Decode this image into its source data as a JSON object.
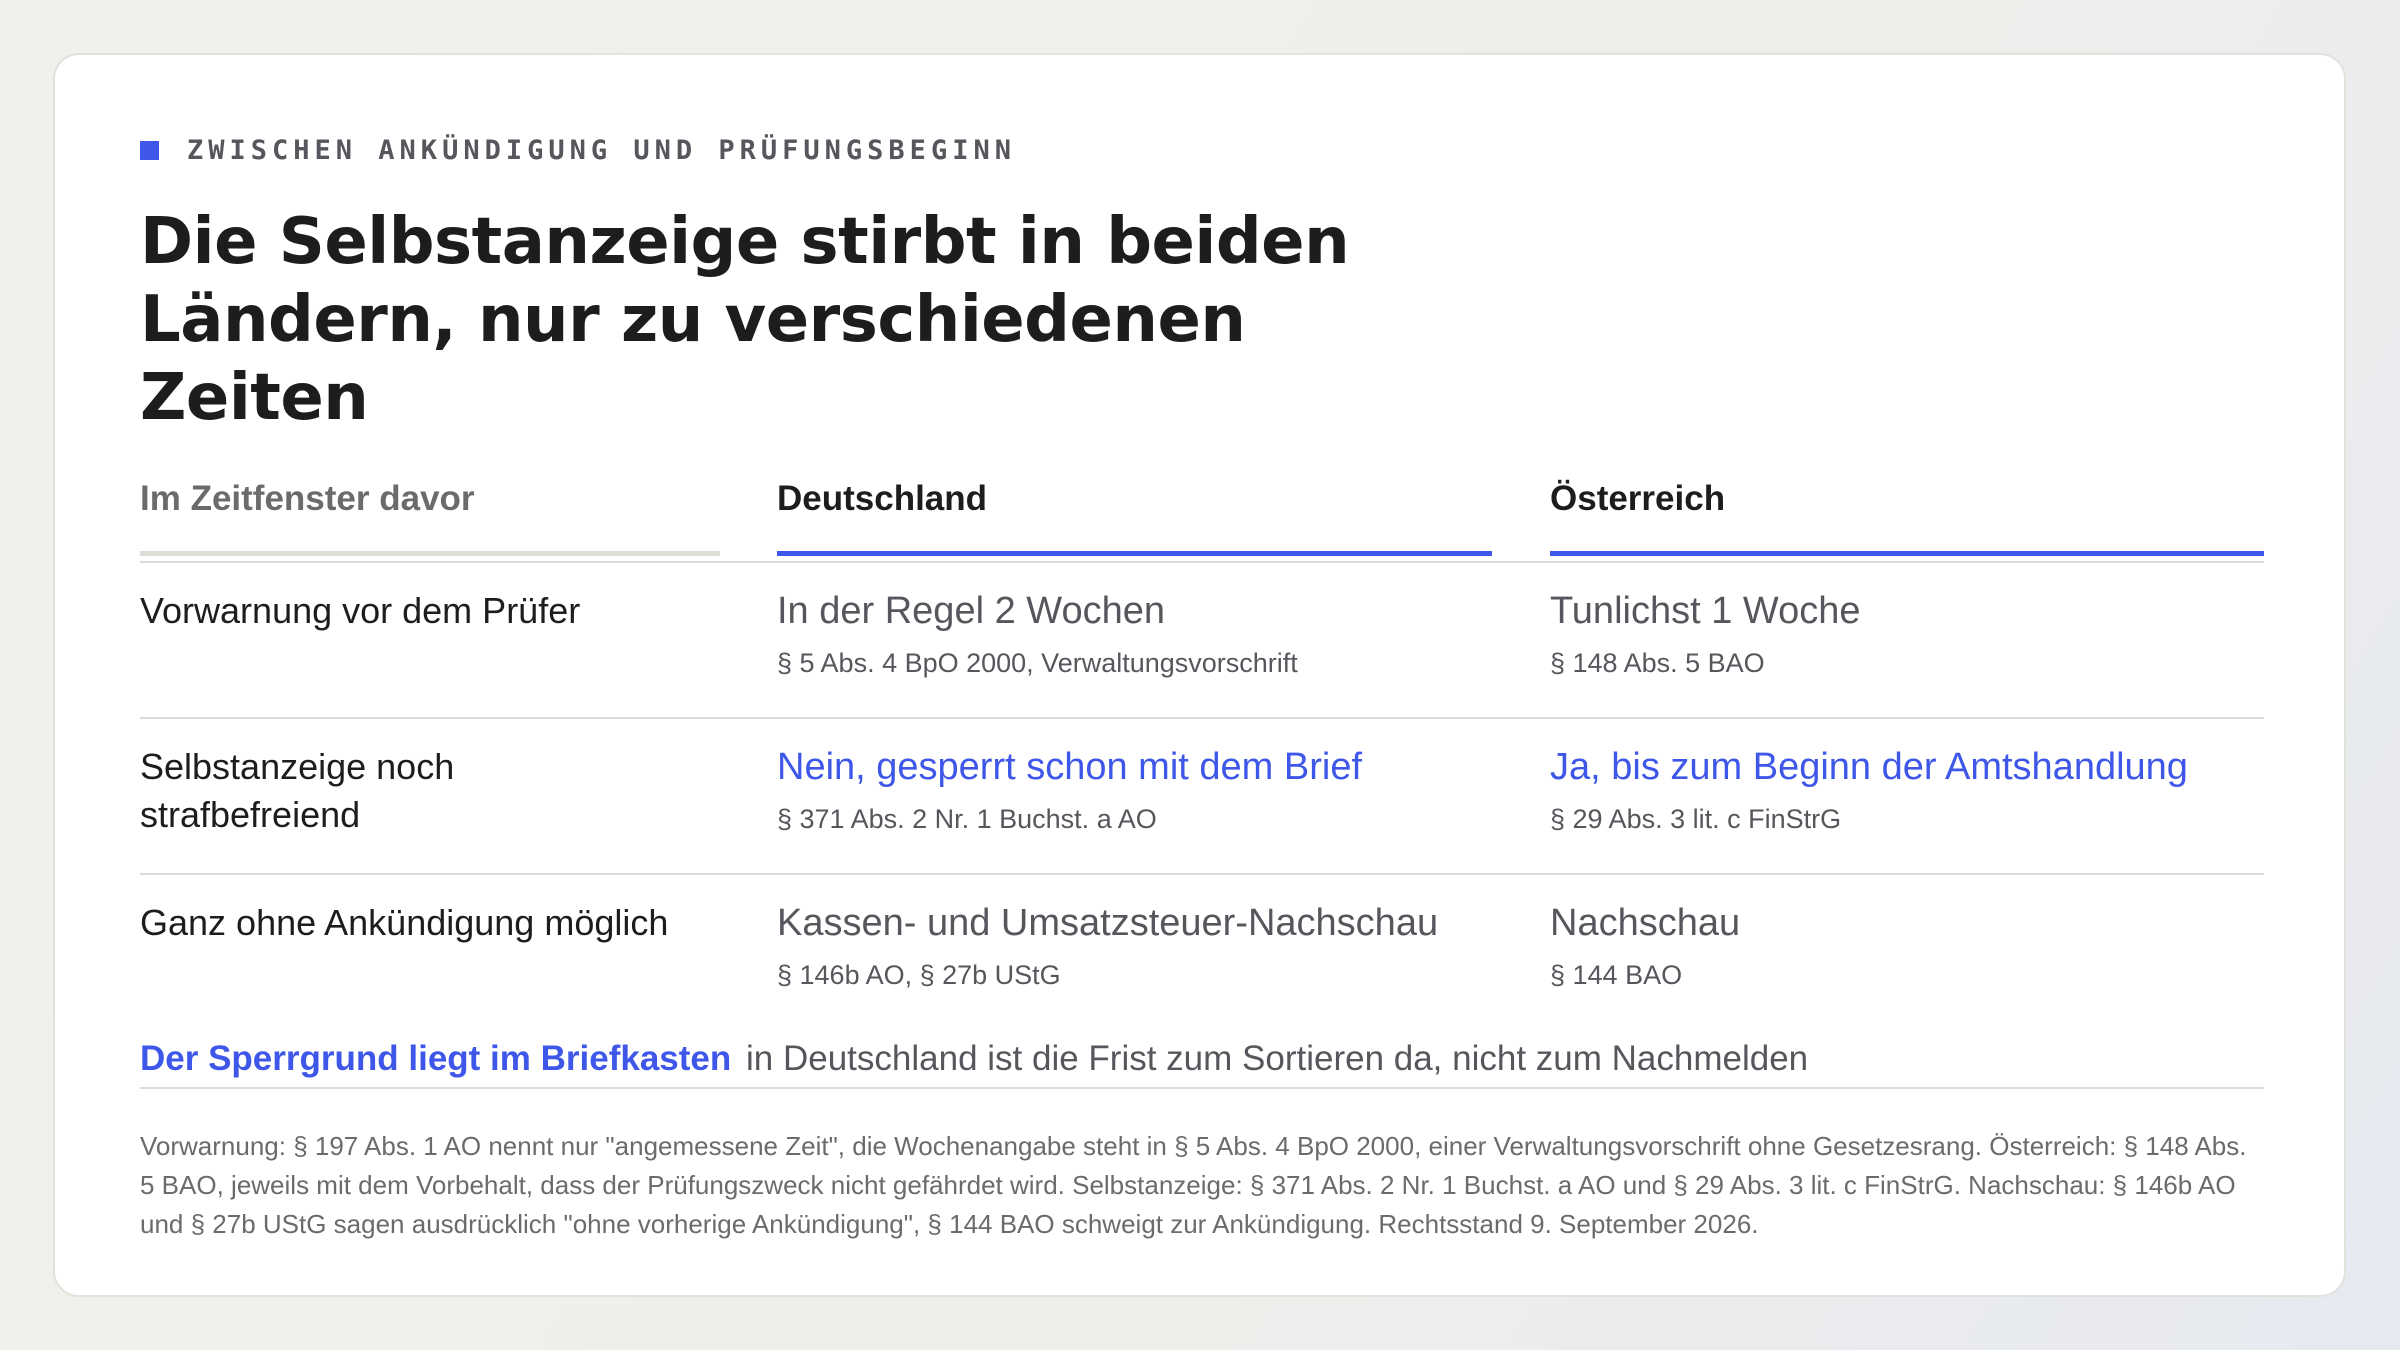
{
  "eyebrow": "ZWISCHEN ANKÜNDIGUNG UND PRÜFUNGSBEGINN",
  "title_line1": "Die Selbstanzeige stirbt in beiden",
  "title_line2": "Ländern, nur zu verschiedenen Zeiten",
  "table": {
    "headers": [
      "Im Zeitfenster davor",
      "Deutschland",
      "Österreich"
    ],
    "rows": [
      {
        "label": "Vorwarnung vor dem Prüfer",
        "de": {
          "value": "In der Regel 2 Wochen",
          "ref": "§ 5 Abs. 4 BpO 2000, Verwaltungsvorschrift"
        },
        "at": {
          "value": "Tunlichst 1 Woche",
          "ref": "§ 148 Abs. 5 BAO"
        }
      },
      {
        "label": "Selbstanzeige noch strafbefreiend",
        "de": {
          "value": "Nein, gesperrt schon mit dem Brief",
          "ref": "§ 371 Abs. 2 Nr. 1 Buchst. a AO"
        },
        "at": {
          "value": "Ja, bis zum Beginn der Amtshandlung",
          "ref": "§ 29 Abs. 3 lit. c FinStrG"
        }
      },
      {
        "label": "Ganz ohne Ankündigung möglich",
        "de": {
          "value": "Kassen- und Umsatzsteuer-Nachschau",
          "ref": "§ 146b AO, § 27b UStG"
        },
        "at": {
          "value": "Nachschau",
          "ref": "§ 144 BAO"
        }
      }
    ]
  },
  "callout": {
    "highlight": "Der Sperrgrund liegt im Briefkasten",
    "text": "in Deutschland ist die Frist zum Sortieren da, nicht zum Nachmelden"
  },
  "footnote": "Vorwarnung: § 197 Abs. 1 AO nennt nur \"angemessene Zeit\", die Wochenangabe steht in § 5 Abs. 4 BpO 2000, einer Verwaltungsvorschrift ohne Gesetzesrang. Österreich: § 148 Abs. 5 BAO, jeweils mit dem Vorbehalt, dass der Prüfungszweck nicht gefährdet wird. Selbstanzeige: § 371 Abs. 2 Nr. 1 Buchst. a AO und § 29 Abs. 3 lit. c FinStrG. Nachschau: § 146b AO und § 27b UStG sagen ausdrücklich \"ohne vorherige Ankündigung\", § 144 BAO schweigt zur Ankündigung. Rechtsstand 9. September 2026.",
  "colors": {
    "accent": "#3e57e8",
    "text": "#1d1d1f",
    "muted": "#55575c"
  }
}
